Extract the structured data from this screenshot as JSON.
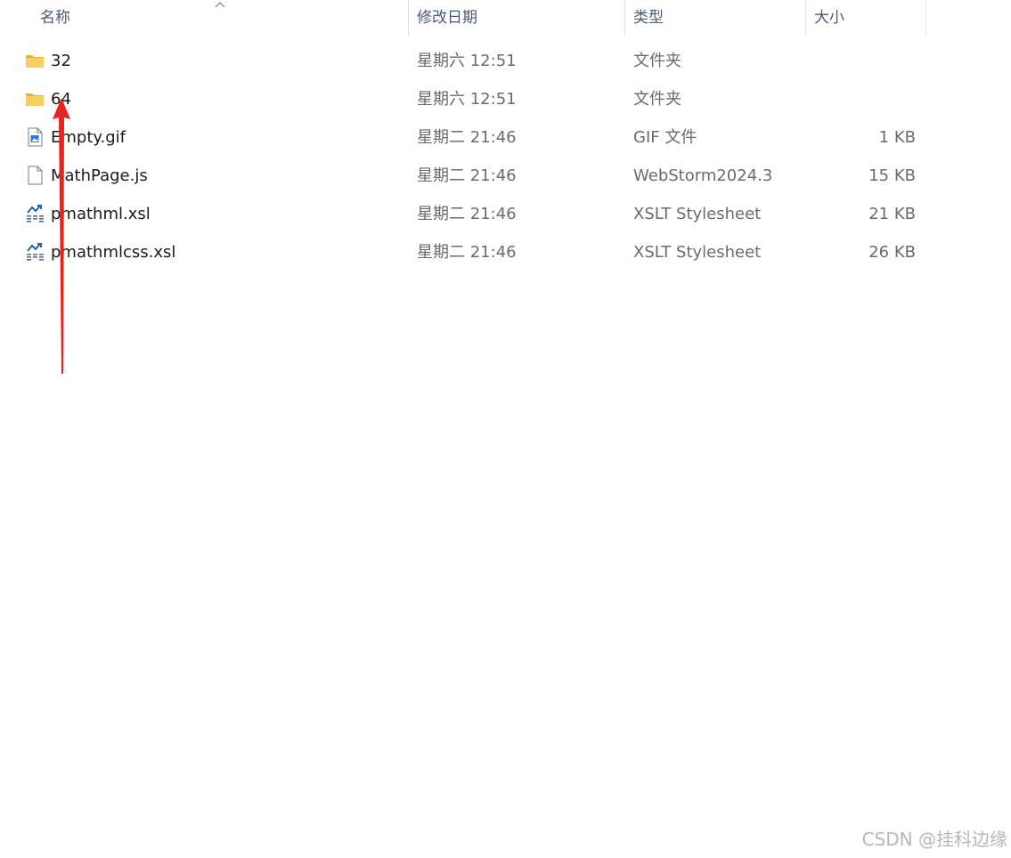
{
  "columns": {
    "name": "名称",
    "date": "修改日期",
    "type": "类型",
    "size": "大小"
  },
  "files": [
    {
      "name": "32",
      "date": "星期六 12:51",
      "type": "文件夹",
      "size": "",
      "icon": "folder-icon"
    },
    {
      "name": "64",
      "date": "星期六 12:51",
      "type": "文件夹",
      "size": "",
      "icon": "folder-icon"
    },
    {
      "name": "Empty.gif",
      "date": "星期二 21:46",
      "type": "GIF 文件",
      "size": "1 KB",
      "icon": "gif-file-icon"
    },
    {
      "name": "MathPage.js",
      "date": "星期二 21:46",
      "type": "WebStorm2024.3",
      "size": "15 KB",
      "icon": "blank-file-icon"
    },
    {
      "name": "pmathml.xsl",
      "date": "星期二 21:46",
      "type": "XSLT Stylesheet",
      "size": "21 KB",
      "icon": "xslt-file-icon"
    },
    {
      "name": "pmathmlcss.xsl",
      "date": "星期二 21:46",
      "type": "XSLT Stylesheet",
      "size": "26 KB",
      "icon": "xslt-file-icon"
    }
  ],
  "watermark": "CSDN @挂科边缘",
  "colors": {
    "folder": "#f4c64a",
    "annotation_arrow": "#e8231f",
    "header_text": "#4a5a78"
  }
}
